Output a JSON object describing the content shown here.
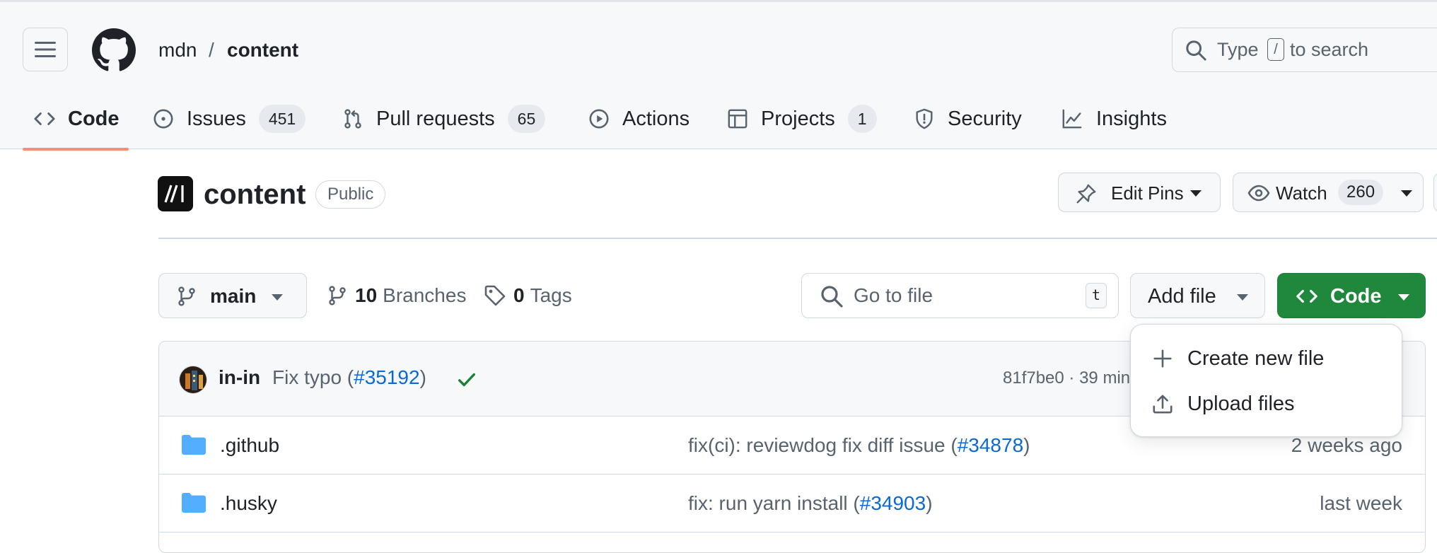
{
  "header": {
    "owner": "mdn",
    "separator": "/",
    "repo": "content",
    "search_placeholder_prefix": "Type",
    "search_key": "/",
    "search_placeholder_suffix": "to search"
  },
  "tabs": [
    {
      "label": "Code",
      "icon": "code-icon",
      "count": null,
      "selected": true
    },
    {
      "label": "Issues",
      "icon": "issue-opened-icon",
      "count": "451"
    },
    {
      "label": "Pull requests",
      "icon": "git-pull-request-icon",
      "count": "65"
    },
    {
      "label": "Actions",
      "icon": "play-icon",
      "count": null
    },
    {
      "label": "Projects",
      "icon": "table-icon",
      "count": "1"
    },
    {
      "label": "Security",
      "icon": "shield-icon",
      "count": null
    },
    {
      "label": "Insights",
      "icon": "graph-icon",
      "count": null
    }
  ],
  "repo_title": {
    "name": "content",
    "visibility": "Public",
    "edit_pins_label": "Edit Pins",
    "watch_label": "Watch",
    "watch_count": "260"
  },
  "toolbar": {
    "branch": "main",
    "branches_count": "10",
    "branches_label": "Branches",
    "tags_count": "0",
    "tags_label": "Tags",
    "go_to_file_placeholder": "Go to file",
    "go_to_file_key": "t",
    "add_file_label": "Add file",
    "code_label": "Code"
  },
  "add_file_menu": {
    "items": [
      {
        "label": "Create new file",
        "icon": "plus-icon"
      },
      {
        "label": "Upload files",
        "icon": "upload-icon"
      }
    ]
  },
  "latest_commit": {
    "author": "in-in",
    "message_prefix": "Fix typo (",
    "pr": "#35192",
    "message_suffix": ")",
    "status": "success",
    "sha_and_time": "81f7be0 · 39 min"
  },
  "files": [
    {
      "name": ".github",
      "msg_prefix": "fix(ci): reviewdog fix diff issue (",
      "pr": "#34878",
      "msg_suffix": ")",
      "time": "2 weeks ago"
    },
    {
      "name": ".husky",
      "msg_prefix": "fix: run yarn install (",
      "pr": "#34903",
      "msg_suffix": ")",
      "time": "last week"
    }
  ],
  "colors": {
    "primary_button": "#1f883d",
    "link": "#0969da",
    "selected_tab_underline": "#fd8c73",
    "folder": "#54aeff"
  }
}
